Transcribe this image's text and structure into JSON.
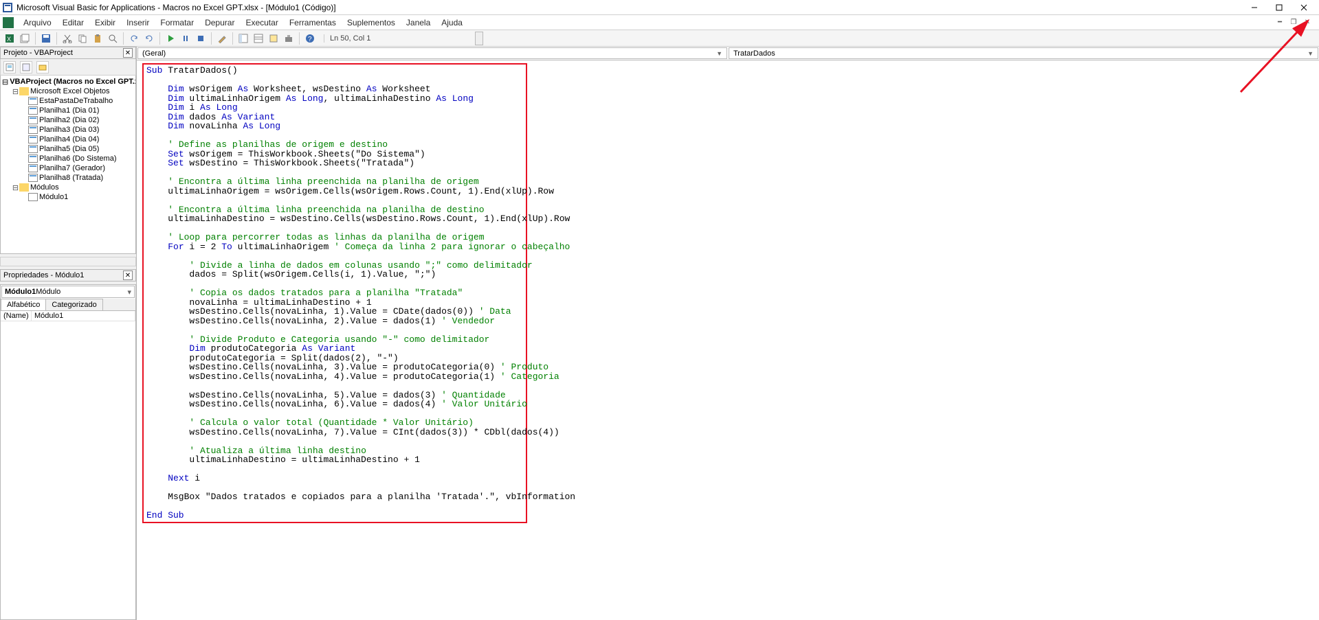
{
  "titlebar": {
    "title": "Microsoft Visual Basic for Applications - Macros no Excel GPT.xlsx - [Módulo1 (Código)]"
  },
  "menubar": {
    "items": [
      "Arquivo",
      "Editar",
      "Exibir",
      "Inserir",
      "Formatar",
      "Depurar",
      "Executar",
      "Ferramentas",
      "Suplementos",
      "Janela",
      "Ajuda"
    ]
  },
  "toolbar": {
    "status": "Ln 50, Col 1"
  },
  "project_panel": {
    "title": "Projeto - VBAProject",
    "root": "VBAProject (Macros no Excel GPT.xlsx)",
    "folder_objects": "Microsoft Excel Objetos",
    "sheets": [
      "EstaPastaDeTrabalho",
      "Planilha1 (Dia 01)",
      "Planilha2 (Dia 02)",
      "Planilha3 (Dia 03)",
      "Planilha4 (Dia 04)",
      "Planilha5 (Dia 05)",
      "Planilha6 (Do Sistema)",
      "Planilha7 (Gerador)",
      "Planilha8 (Tratada)"
    ],
    "folder_modules": "Módulos",
    "module": "Módulo1"
  },
  "properties_panel": {
    "title": "Propriedades - Módulo1",
    "combo_bold": "Módulo1",
    "combo_type": " Módulo",
    "tabs": [
      "Alfabético",
      "Categorizado"
    ],
    "rows": [
      {
        "key": "(Name)",
        "val": "Módulo1"
      }
    ]
  },
  "code_dropdowns": {
    "left": "(Geral)",
    "right": "TratarDados"
  },
  "code": [
    [
      [
        "kw",
        "Sub"
      ],
      [
        "tx",
        " TratarDados()"
      ]
    ],
    [],
    [
      [
        "tx",
        "    "
      ],
      [
        "kw",
        "Dim"
      ],
      [
        "tx",
        " wsOrigem "
      ],
      [
        "kw",
        "As"
      ],
      [
        "tx",
        " Worksheet, wsDestino "
      ],
      [
        "kw",
        "As"
      ],
      [
        "tx",
        " Worksheet"
      ]
    ],
    [
      [
        "tx",
        "    "
      ],
      [
        "kw",
        "Dim"
      ],
      [
        "tx",
        " ultimaLinhaOrigem "
      ],
      [
        "kw",
        "As"
      ],
      [
        "tx",
        " "
      ],
      [
        "kw",
        "Long"
      ],
      [
        "tx",
        ", ultimaLinhaDestino "
      ],
      [
        "kw",
        "As"
      ],
      [
        "tx",
        " "
      ],
      [
        "kw",
        "Long"
      ]
    ],
    [
      [
        "tx",
        "    "
      ],
      [
        "kw",
        "Dim"
      ],
      [
        "tx",
        " i "
      ],
      [
        "kw",
        "As"
      ],
      [
        "tx",
        " "
      ],
      [
        "kw",
        "Long"
      ]
    ],
    [
      [
        "tx",
        "    "
      ],
      [
        "kw",
        "Dim"
      ],
      [
        "tx",
        " dados "
      ],
      [
        "kw",
        "As"
      ],
      [
        "tx",
        " "
      ],
      [
        "kw",
        "Variant"
      ]
    ],
    [
      [
        "tx",
        "    "
      ],
      [
        "kw",
        "Dim"
      ],
      [
        "tx",
        " novaLinha "
      ],
      [
        "kw",
        "As"
      ],
      [
        "tx",
        " "
      ],
      [
        "kw",
        "Long"
      ]
    ],
    [],
    [
      [
        "tx",
        "    "
      ],
      [
        "cm",
        "' Define as planilhas de origem e destino"
      ]
    ],
    [
      [
        "tx",
        "    "
      ],
      [
        "kw",
        "Set"
      ],
      [
        "tx",
        " wsOrigem = ThisWorkbook.Sheets(\"Do Sistema\")"
      ]
    ],
    [
      [
        "tx",
        "    "
      ],
      [
        "kw",
        "Set"
      ],
      [
        "tx",
        " wsDestino = ThisWorkbook.Sheets(\"Tratada\")"
      ]
    ],
    [],
    [
      [
        "tx",
        "    "
      ],
      [
        "cm",
        "' Encontra a última linha preenchida na planilha de origem"
      ]
    ],
    [
      [
        "tx",
        "    ultimaLinhaOrigem = wsOrigem.Cells(wsOrigem.Rows.Count, 1).End(xlUp).Row"
      ]
    ],
    [],
    [
      [
        "tx",
        "    "
      ],
      [
        "cm",
        "' Encontra a última linha preenchida na planilha de destino"
      ]
    ],
    [
      [
        "tx",
        "    ultimaLinhaDestino = wsDestino.Cells(wsDestino.Rows.Count, 1).End(xlUp).Row"
      ]
    ],
    [],
    [
      [
        "tx",
        "    "
      ],
      [
        "cm",
        "' Loop para percorrer todas as linhas da planilha de origem"
      ]
    ],
    [
      [
        "tx",
        "    "
      ],
      [
        "kw",
        "For"
      ],
      [
        "tx",
        " i = 2 "
      ],
      [
        "kw",
        "To"
      ],
      [
        "tx",
        " ultimaLinhaOrigem "
      ],
      [
        "cm",
        "' Começa da linha 2 para ignorar o cabeçalho"
      ]
    ],
    [],
    [
      [
        "tx",
        "        "
      ],
      [
        "cm",
        "' Divide a linha de dados em colunas usando \";\" como delimitador"
      ]
    ],
    [
      [
        "tx",
        "        dados = Split(wsOrigem.Cells(i, 1).Value, \";\")"
      ]
    ],
    [],
    [
      [
        "tx",
        "        "
      ],
      [
        "cm",
        "' Copia os dados tratados para a planilha \"Tratada\""
      ]
    ],
    [
      [
        "tx",
        "        novaLinha = ultimaLinhaDestino + 1"
      ]
    ],
    [
      [
        "tx",
        "        wsDestino.Cells(novaLinha, 1).Value = CDate(dados(0)) "
      ],
      [
        "cm",
        "' Data"
      ]
    ],
    [
      [
        "tx",
        "        wsDestino.Cells(novaLinha, 2).Value = dados(1) "
      ],
      [
        "cm",
        "' Vendedor"
      ]
    ],
    [],
    [
      [
        "tx",
        "        "
      ],
      [
        "cm",
        "' Divide Produto e Categoria usando \"-\" como delimitador"
      ]
    ],
    [
      [
        "tx",
        "        "
      ],
      [
        "kw",
        "Dim"
      ],
      [
        "tx",
        " produtoCategoria "
      ],
      [
        "kw",
        "As"
      ],
      [
        "tx",
        " "
      ],
      [
        "kw",
        "Variant"
      ]
    ],
    [
      [
        "tx",
        "        produtoCategoria = Split(dados(2), \"-\")"
      ]
    ],
    [
      [
        "tx",
        "        wsDestino.Cells(novaLinha, 3).Value = produtoCategoria(0) "
      ],
      [
        "cm",
        "' Produto"
      ]
    ],
    [
      [
        "tx",
        "        wsDestino.Cells(novaLinha, 4).Value = produtoCategoria(1) "
      ],
      [
        "cm",
        "' Categoria"
      ]
    ],
    [],
    [
      [
        "tx",
        "        wsDestino.Cells(novaLinha, 5).Value = dados(3) "
      ],
      [
        "cm",
        "' Quantidade"
      ]
    ],
    [
      [
        "tx",
        "        wsDestino.Cells(novaLinha, 6).Value = dados(4) "
      ],
      [
        "cm",
        "' Valor Unitário"
      ]
    ],
    [],
    [
      [
        "tx",
        "        "
      ],
      [
        "cm",
        "' Calcula o valor total (Quantidade * Valor Unitário)"
      ]
    ],
    [
      [
        "tx",
        "        wsDestino.Cells(novaLinha, 7).Value = CInt(dados(3)) * CDbl(dados(4))"
      ]
    ],
    [],
    [
      [
        "tx",
        "        "
      ],
      [
        "cm",
        "' Atualiza a última linha destino"
      ]
    ],
    [
      [
        "tx",
        "        ultimaLinhaDestino = ultimaLinhaDestino + 1"
      ]
    ],
    [],
    [
      [
        "tx",
        "    "
      ],
      [
        "kw",
        "Next"
      ],
      [
        "tx",
        " i"
      ]
    ],
    [],
    [
      [
        "tx",
        "    MsgBox \"Dados tratados e copiados para a planilha 'Tratada'.\", vbInformation"
      ]
    ],
    [],
    [
      [
        "kw",
        "End Sub"
      ]
    ]
  ]
}
